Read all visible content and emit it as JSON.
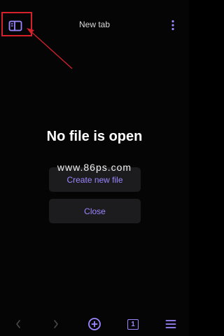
{
  "header": {
    "tab_title": "New tab",
    "icons": {
      "sidebar_toggle": "sidebar-toggle-icon",
      "more": "vertical-dots-icon"
    }
  },
  "empty_state": {
    "title": "No file is open",
    "create_label": "Create new file",
    "close_label": "Close"
  },
  "watermark": "www.86ps.com",
  "bottom_bar": {
    "back_icon": "chevron-left-icon",
    "forward_icon": "chevron-right-icon",
    "new_tab_icon": "plus-circle-icon",
    "tab_count": "1",
    "menu_icon": "hamburger-icon"
  },
  "colors": {
    "accent": "#9d86ff",
    "background": "#050505",
    "button_bg": "#1c1c1e",
    "annotation": "#d4212a"
  }
}
